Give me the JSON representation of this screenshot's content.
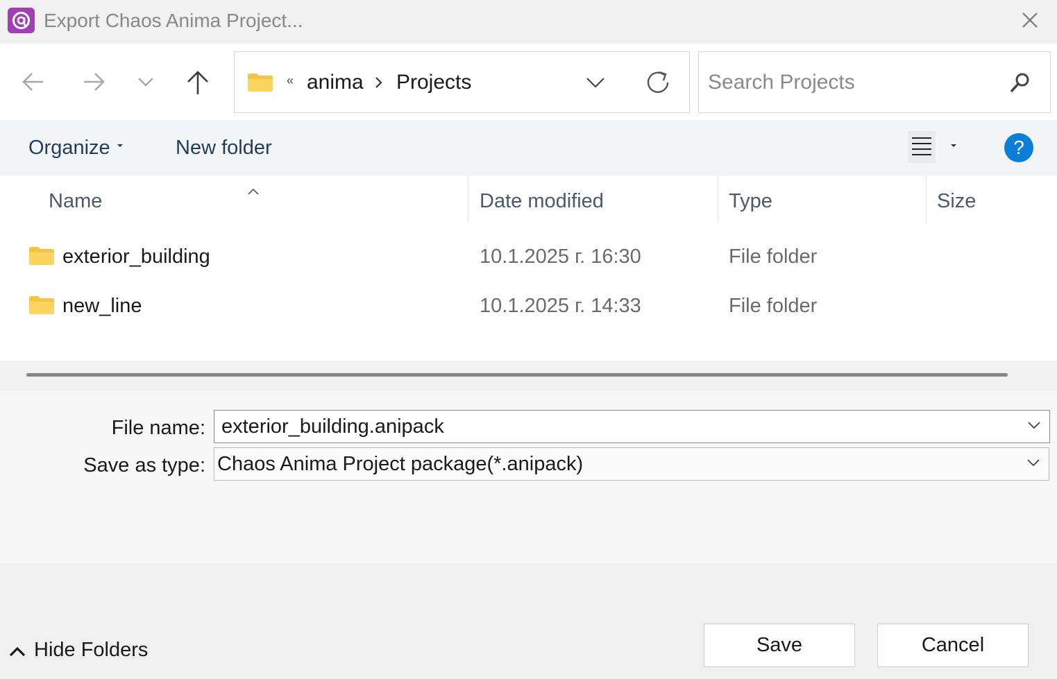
{
  "window": {
    "title": "Export Chaos Anima Project...",
    "app_icon": "anima-logo-icon",
    "accent_color": "#a13fb4"
  },
  "nav": {
    "back_icon": "arrow-left-icon",
    "forward_icon": "arrow-right-icon",
    "recent_icon": "chevron-down-icon",
    "up_icon": "arrow-up-icon"
  },
  "address_bar": {
    "overflow": "«",
    "breadcrumbs": [
      "anima",
      "Projects"
    ],
    "refresh_icon": "refresh-icon"
  },
  "search": {
    "placeholder": "Search Projects",
    "icon": "search-icon"
  },
  "toolbar": {
    "organize": "Organize",
    "new_folder": "New folder",
    "view_icon": "list-view-icon",
    "help": "?",
    "help_color": "#0a7fd6"
  },
  "file_list": {
    "columns": [
      "Name",
      "Date modified",
      "Type",
      "Size"
    ],
    "sorted_by": "Name",
    "rows": [
      {
        "name": "exterior_building",
        "date": "10.1.2025 г. 16:30",
        "type": "File folder",
        "size": ""
      },
      {
        "name": "new_line",
        "date": "10.1.2025 г. 14:33",
        "type": "File folder",
        "size": ""
      }
    ]
  },
  "save_panel": {
    "file_name_label": "File name:",
    "file_name_value": "exterior_building.anipack",
    "save_type_label": "Save as type:",
    "save_type_value": "Chaos Anima Project package(*.anipack)"
  },
  "footer": {
    "hide_folders": "Hide Folders",
    "save": "Save",
    "cancel": "Cancel"
  }
}
